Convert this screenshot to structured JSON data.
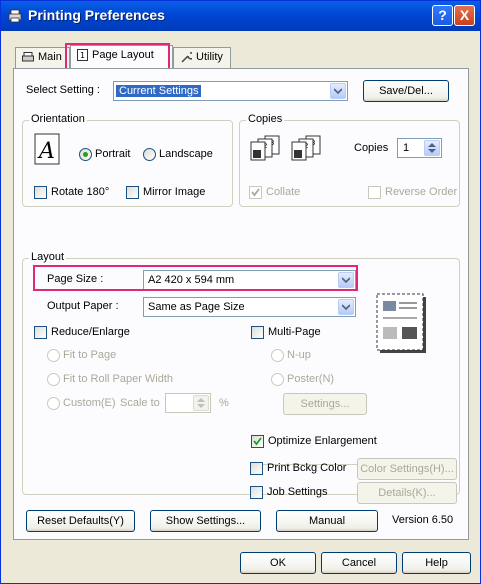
{
  "window": {
    "title": "Printing Preferences",
    "help_btn": "?",
    "close_btn": "X"
  },
  "tabs": [
    {
      "label": "Main",
      "icon": "printer-icon"
    },
    {
      "label": "Page Layout",
      "icon": "page-layout-icon"
    },
    {
      "label": "Utility",
      "icon": "wrench-icon"
    }
  ],
  "select_setting": {
    "label": "Select Setting :",
    "value": "Current Settings",
    "save_del": "Save/Del..."
  },
  "orientation": {
    "title": "Orientation",
    "portrait": "Portrait",
    "landscape": "Landscape",
    "selected": "Portrait",
    "rotate180": "Rotate 180°",
    "mirror": "Mirror Image"
  },
  "copies": {
    "title": "Copies",
    "label": "Copies",
    "value": "1",
    "collate": "Collate",
    "reverse": "Reverse Order"
  },
  "layout": {
    "title": "Layout",
    "page_size_label": "Page Size :",
    "page_size_value": "A2 420 x 594 mm",
    "output_paper_label": "Output Paper :",
    "output_paper_value": "Same as Page Size",
    "reduce_enlarge": "Reduce/Enlarge",
    "fit_page": "Fit to Page",
    "fit_roll": "Fit to Roll Paper Width",
    "custom": "Custom(E)",
    "scale_to": "Scale to",
    "percent": "%",
    "multi_page": "Multi-Page",
    "nup": "N-up",
    "poster": "Poster(N)",
    "settings_btn": "Settings...",
    "optimize": "Optimize Enlargement",
    "print_bckg": "Print Bckg Color",
    "color_settings": "Color Settings(H)...",
    "job_settings": "Job Settings",
    "details": "Details(K)..."
  },
  "bottom": {
    "reset": "Reset Defaults(Y)",
    "show_settings": "Show Settings...",
    "manual": "Manual",
    "version": "Version 6.50"
  },
  "dialog": {
    "ok": "OK",
    "cancel": "Cancel",
    "help": "Help"
  },
  "colors": {
    "highlight": "#e0287a",
    "titlebar": "#0046d5",
    "panel_bg": "#fcfcfe",
    "window_bg": "#ece9d8"
  }
}
